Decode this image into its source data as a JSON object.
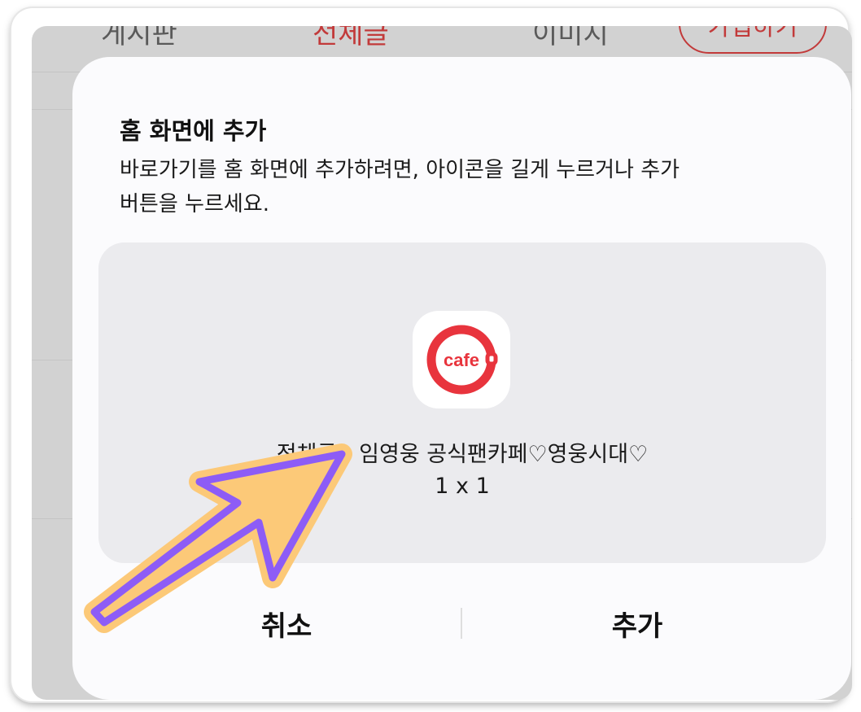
{
  "background_tabs": [
    "게시판",
    "전체글",
    "이미지"
  ],
  "background_join_button": "가입하기",
  "dialog": {
    "title": "홈 화면에 추가",
    "description_line1": "바로가기를 홈 화면에 추가하려면, 아이콘을 길게 누르거나 추가",
    "description_line2": "버튼을 누르세요.",
    "shortcut": {
      "icon": "cafe-app-icon",
      "icon_text": "cafe",
      "name": "전체글 - 임영웅 공식팬카페♡영웅시대♡",
      "size": "1 x 1"
    },
    "cancel_label": "취소",
    "add_label": "추가"
  },
  "colors": {
    "accent_red": "#e8343d",
    "annotation_arrow_fill": "#fcc978",
    "annotation_arrow_stroke": "#8d5cf6",
    "dialog_bg": "#fbfbfd",
    "preview_bg": "#ebebee"
  }
}
